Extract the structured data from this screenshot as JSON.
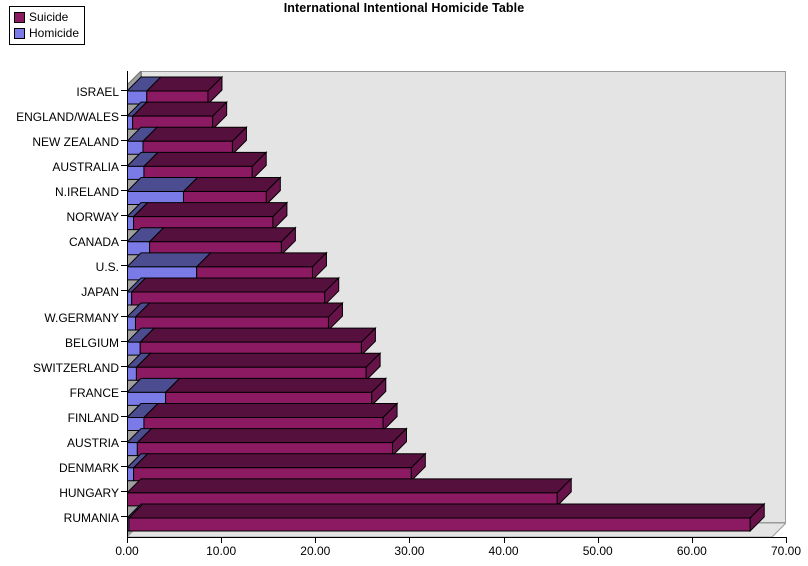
{
  "title": "International Intentional Homicide Table",
  "legend": {
    "items": [
      {
        "label": "Suicide",
        "color": "#8B1A62"
      },
      {
        "label": "Homicide",
        "color": "#7B7BE8"
      }
    ]
  },
  "axis": {
    "x_ticks": [
      "0.00",
      "10.00",
      "20.00",
      "30.00",
      "40.00",
      "50.00",
      "60.00",
      "70.00"
    ],
    "x_min": 0,
    "x_max": 70
  },
  "chart_data": {
    "type": "bar",
    "orientation": "horizontal",
    "stacked": true,
    "three_d": true,
    "title": "International Intentional Homicide Table",
    "xlabel": "",
    "ylabel": "",
    "xlim": [
      0,
      70
    ],
    "grid": false,
    "legend_position": "top-left",
    "categories": [
      "ISRAEL",
      "ENGLAND/WALES",
      "NEW ZEALAND",
      "AUSTRALIA",
      "N.IRELAND",
      "NORWAY",
      "CANADA",
      "U.S.",
      "JAPAN",
      "W.GERMANY",
      "BELGIUM",
      "SWITZERLAND",
      "FRANCE",
      "FINLAND",
      "AUSTRIA",
      "DENMARK",
      "HUNGARY",
      "RUMANIA"
    ],
    "series": [
      {
        "name": "Homicide",
        "color": "#7B7BE8",
        "values": [
          2.1,
          0.6,
          1.7,
          1.8,
          6.0,
          0.7,
          2.4,
          7.4,
          0.5,
          0.9,
          1.4,
          1.0,
          4.1,
          1.8,
          1.1,
          0.7,
          0.0,
          0.2
        ]
      },
      {
        "name": "Suicide",
        "color": "#8B1A62",
        "values": [
          6.5,
          8.5,
          9.5,
          11.5,
          8.8,
          14.8,
          14.0,
          12.3,
          20.5,
          20.5,
          23.5,
          24.4,
          21.9,
          25.4,
          27.1,
          29.5,
          45.7,
          66.0
        ]
      }
    ],
    "totals": [
      8.6,
      9.1,
      11.2,
      13.3,
      14.8,
      15.5,
      16.4,
      19.7,
      21.0,
      21.4,
      24.9,
      25.4,
      26.0,
      27.2,
      28.2,
      30.2,
      45.7,
      66.2
    ]
  },
  "colors": {
    "plot_background": "#e4e4e4",
    "depth_wall": "#a0a0a0",
    "suicide_front": "#8B1A62",
    "suicide_top": "#5C1242",
    "suicide_side": "#6B1450",
    "homicide_front": "#8585EE",
    "homicide_top": "#5A5AC0",
    "homicide_side": "#6A6AD4",
    "axis": "#000000"
  }
}
